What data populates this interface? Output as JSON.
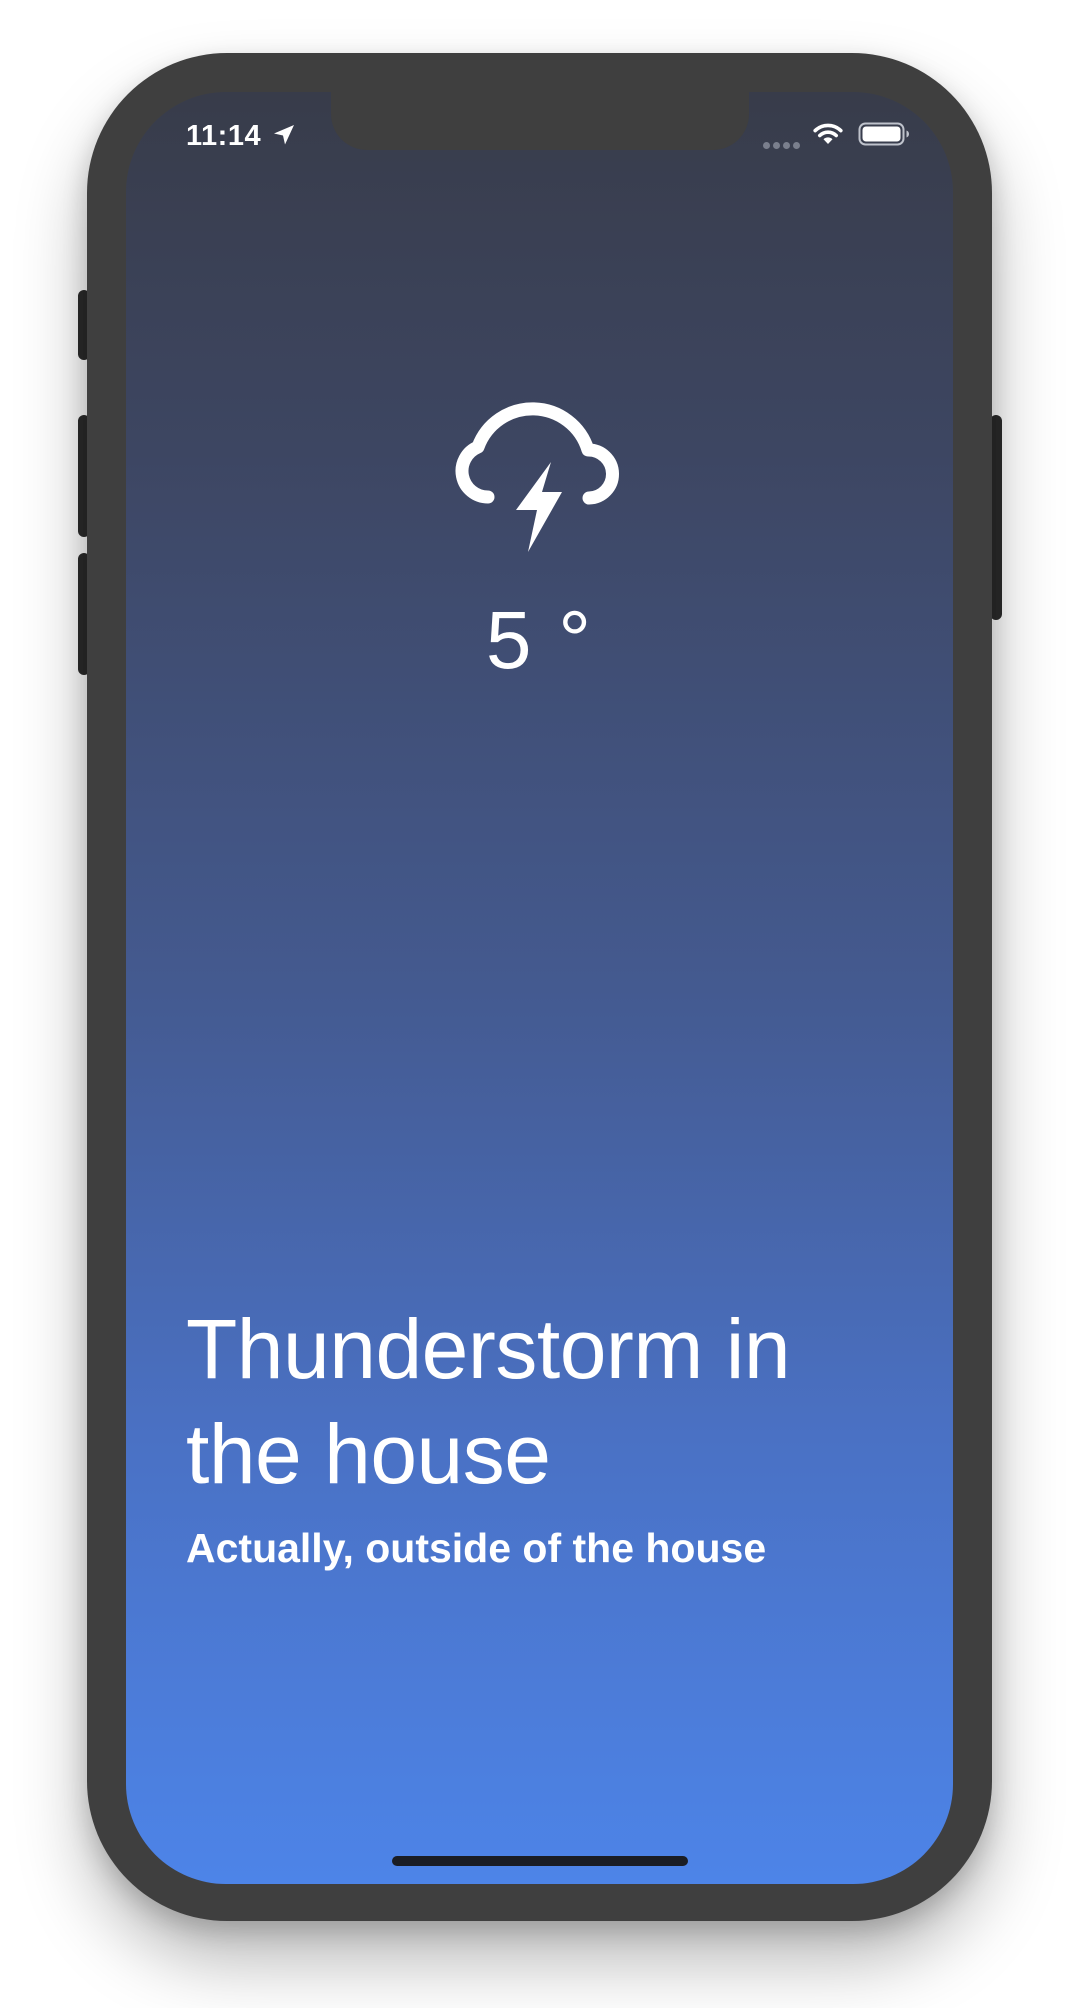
{
  "status_bar": {
    "time": "11:14",
    "location_icon": "location-arrow-icon",
    "signal_icon": "cellular-signal-icon",
    "wifi_icon": "wifi-icon",
    "battery_icon": "battery-full-icon"
  },
  "weather": {
    "condition_icon": "cloud-lightning-icon",
    "temperature": "5 °",
    "headline": "Thunderstorm in the house",
    "subtitle": "Actually, outside of the house"
  },
  "colors": {
    "gradient_top": "#383c4a",
    "gradient_bottom": "#4d84e8",
    "device_frame": "#3f3f3f",
    "text": "#ffffff"
  }
}
